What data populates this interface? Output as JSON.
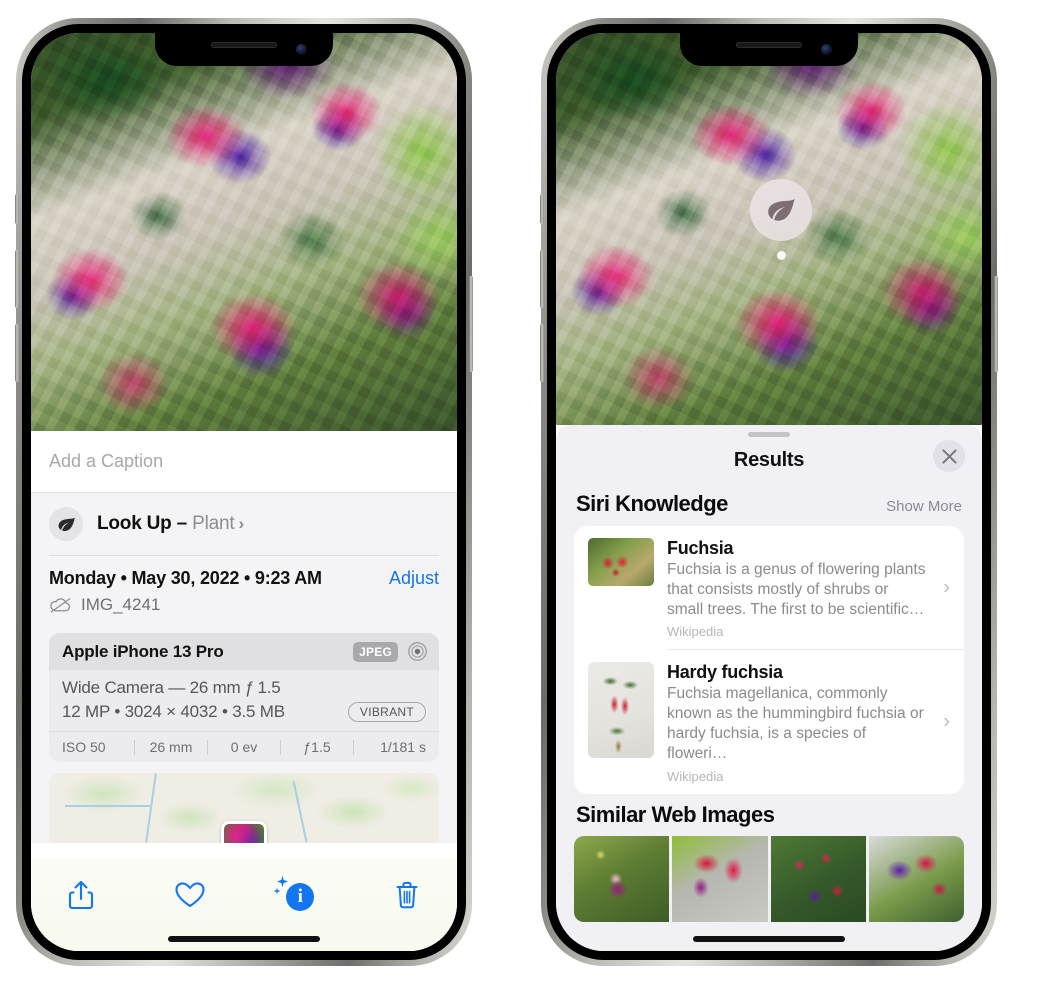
{
  "left_phone": {
    "photo": {
      "alt": "fuchsia-flowers-photo"
    },
    "caption_placeholder": "Add a Caption",
    "caption_value": "",
    "lookup": {
      "icon": "leaf-icon",
      "label": "Look Up – ",
      "subject": "Plant",
      "chevron": "›"
    },
    "meta": {
      "date": "Monday • May 30, 2022 • 9:23 AM",
      "adjust_label": "Adjust",
      "cloud_icon": "cloud-slash-icon",
      "filename": "IMG_4241"
    },
    "camera_card": {
      "device": "Apple iPhone 13 Pro",
      "format_badge": "JPEG",
      "aperture_icon": "aperture-icon",
      "lens_line": "Wide Camera — 26 mm ƒ 1.5",
      "specs_line": "12 MP • 3024 × 4032 • 3.5 MB",
      "style_badge": "VIBRANT",
      "exif": [
        "ISO 50",
        "26 mm",
        "0 ev",
        "ƒ1.5",
        "1/181 s"
      ]
    },
    "map": {
      "name": "photo-location-map"
    },
    "toolbar": {
      "share": "share-icon",
      "favorite": "heart-icon",
      "info": "info-sparkle-icon",
      "info_glyph": "i",
      "delete": "trash-icon"
    }
  },
  "right_phone": {
    "leaf_badge": "leaf-icon",
    "sheet": {
      "title": "Results",
      "close_icon": "close-icon"
    },
    "siri_knowledge": {
      "title": "Siri Knowledge",
      "show_more": "Show More",
      "items": [
        {
          "name": "Fuchsia",
          "desc": "Fuchsia is a genus of flowering plants that consists mostly of shrubs or small trees. The first to be scientific…",
          "source": "Wikipedia",
          "chevron": "›"
        },
        {
          "name": "Hardy fuchsia",
          "desc": "Fuchsia magellanica, commonly known as the hummingbird fuchsia or hardy fuchsia, is a species of floweri…",
          "source": "Wikipedia",
          "chevron": "›"
        }
      ]
    },
    "similar_web_images": {
      "title": "Similar Web Images",
      "thumbs": [
        "web-image-1",
        "web-image-2",
        "web-image-3",
        "web-image-4"
      ]
    }
  },
  "colors": {
    "accent_blue": "#1276f0",
    "sheet_bg": "#f1f0f5",
    "card_bg": "#ffffff",
    "secondary_text": "#8a8a90"
  }
}
